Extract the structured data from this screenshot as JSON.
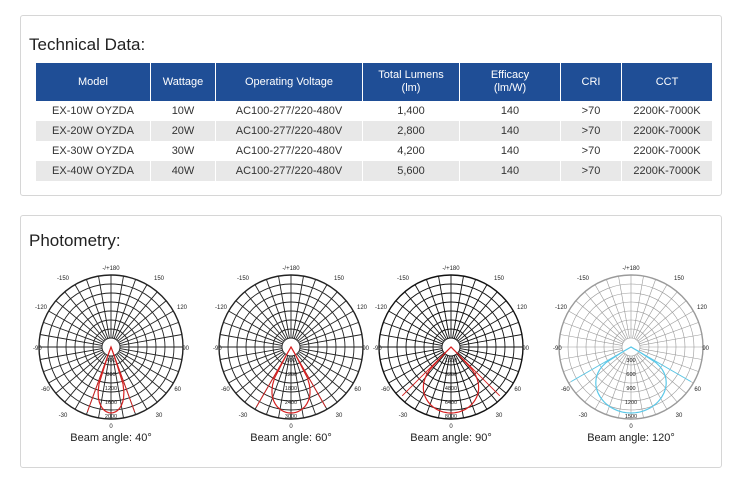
{
  "tech": {
    "title": "Technical Data:",
    "headers": [
      "Model",
      "Wattage",
      "Operating Voltage",
      "Total Lumens\n(lm)",
      "Efficacy\n(lm/W)",
      "CRI",
      "CCT"
    ],
    "rows": [
      [
        "EX-10W OYZDA",
        "10W",
        "AC100-277/220-480V",
        "1,400",
        "140",
        ">70",
        "2200K-7000K"
      ],
      [
        "EX-20W OYZDA",
        "20W",
        "AC100-277/220-480V",
        "2,800",
        "140",
        ">70",
        "2200K-7000K"
      ],
      [
        "EX-30W OYZDA",
        "30W",
        "AC100-277/220-480V",
        "4,200",
        "140",
        ">70",
        "2200K-7000K"
      ],
      [
        "EX-40W OYZDA",
        "40W",
        "AC100-277/220-480V",
        "5,600",
        "140",
        ">70",
        "2200K-7000K"
      ]
    ]
  },
  "photometry": {
    "title": "Photometry:",
    "diagrams": [
      {
        "caption": "Beam angle: 40°",
        "grid_color": "#222222",
        "curve_color": "#d62020",
        "beam_half_angle": 20,
        "angle_labels": {
          "top": "-/+180",
          "ul": "-150",
          "ur": "150",
          "l1": "-120",
          "r1": "120",
          "l2": "-90",
          "r2": "90",
          "l3": "-60",
          "r3": "60",
          "ll": "-30",
          "lr": "30",
          "bottom": "0"
        },
        "radial_labels": [
          "400",
          "800",
          "1200",
          "1600",
          "2000"
        ]
      },
      {
        "caption": "Beam angle: 60°",
        "grid_color": "#222222",
        "curve_color": "#d62020",
        "beam_half_angle": 30,
        "angle_labels": {
          "top": "-/+180",
          "ul": "-150",
          "ur": "150",
          "l1": "-120",
          "r1": "120",
          "l2": "-90",
          "r2": "90",
          "l3": "-60",
          "r3": "60",
          "ll": "-30",
          "lr": "30",
          "bottom": "0"
        },
        "radial_labels": [
          "600",
          "1200",
          "1800",
          "2400",
          "3000"
        ]
      },
      {
        "caption": "Beam angle: 90°",
        "grid_color": "#111111",
        "curve_color": "#d62020",
        "beam_half_angle": 45,
        "angle_labels": {
          "top": "-/+180",
          "ul": "-150",
          "ur": "150",
          "l1": "-120",
          "r1": "120",
          "l2": "-90",
          "r2": "90",
          "l3": "-60",
          "r3": "60",
          "ll": "-30",
          "lr": "30",
          "bottom": "0"
        },
        "radial_labels": [
          "1600",
          "3200",
          "4800",
          "6400",
          "8000"
        ]
      },
      {
        "caption": "Beam angle: 120°",
        "grid_color": "#9a9a9a",
        "curve_color": "#5bc8e8",
        "beam_half_angle": 60,
        "angle_labels": {
          "top": "-/+180",
          "ul": "-150",
          "ur": "150",
          "l1": "-120",
          "r1": "120",
          "l2": "-90",
          "r2": "90",
          "l3": "-60",
          "r3": "60",
          "ll": "-30",
          "lr": "30",
          "bottom": "0"
        },
        "radial_labels": [
          "300",
          "600",
          "900",
          "1200",
          "1500"
        ]
      }
    ]
  }
}
